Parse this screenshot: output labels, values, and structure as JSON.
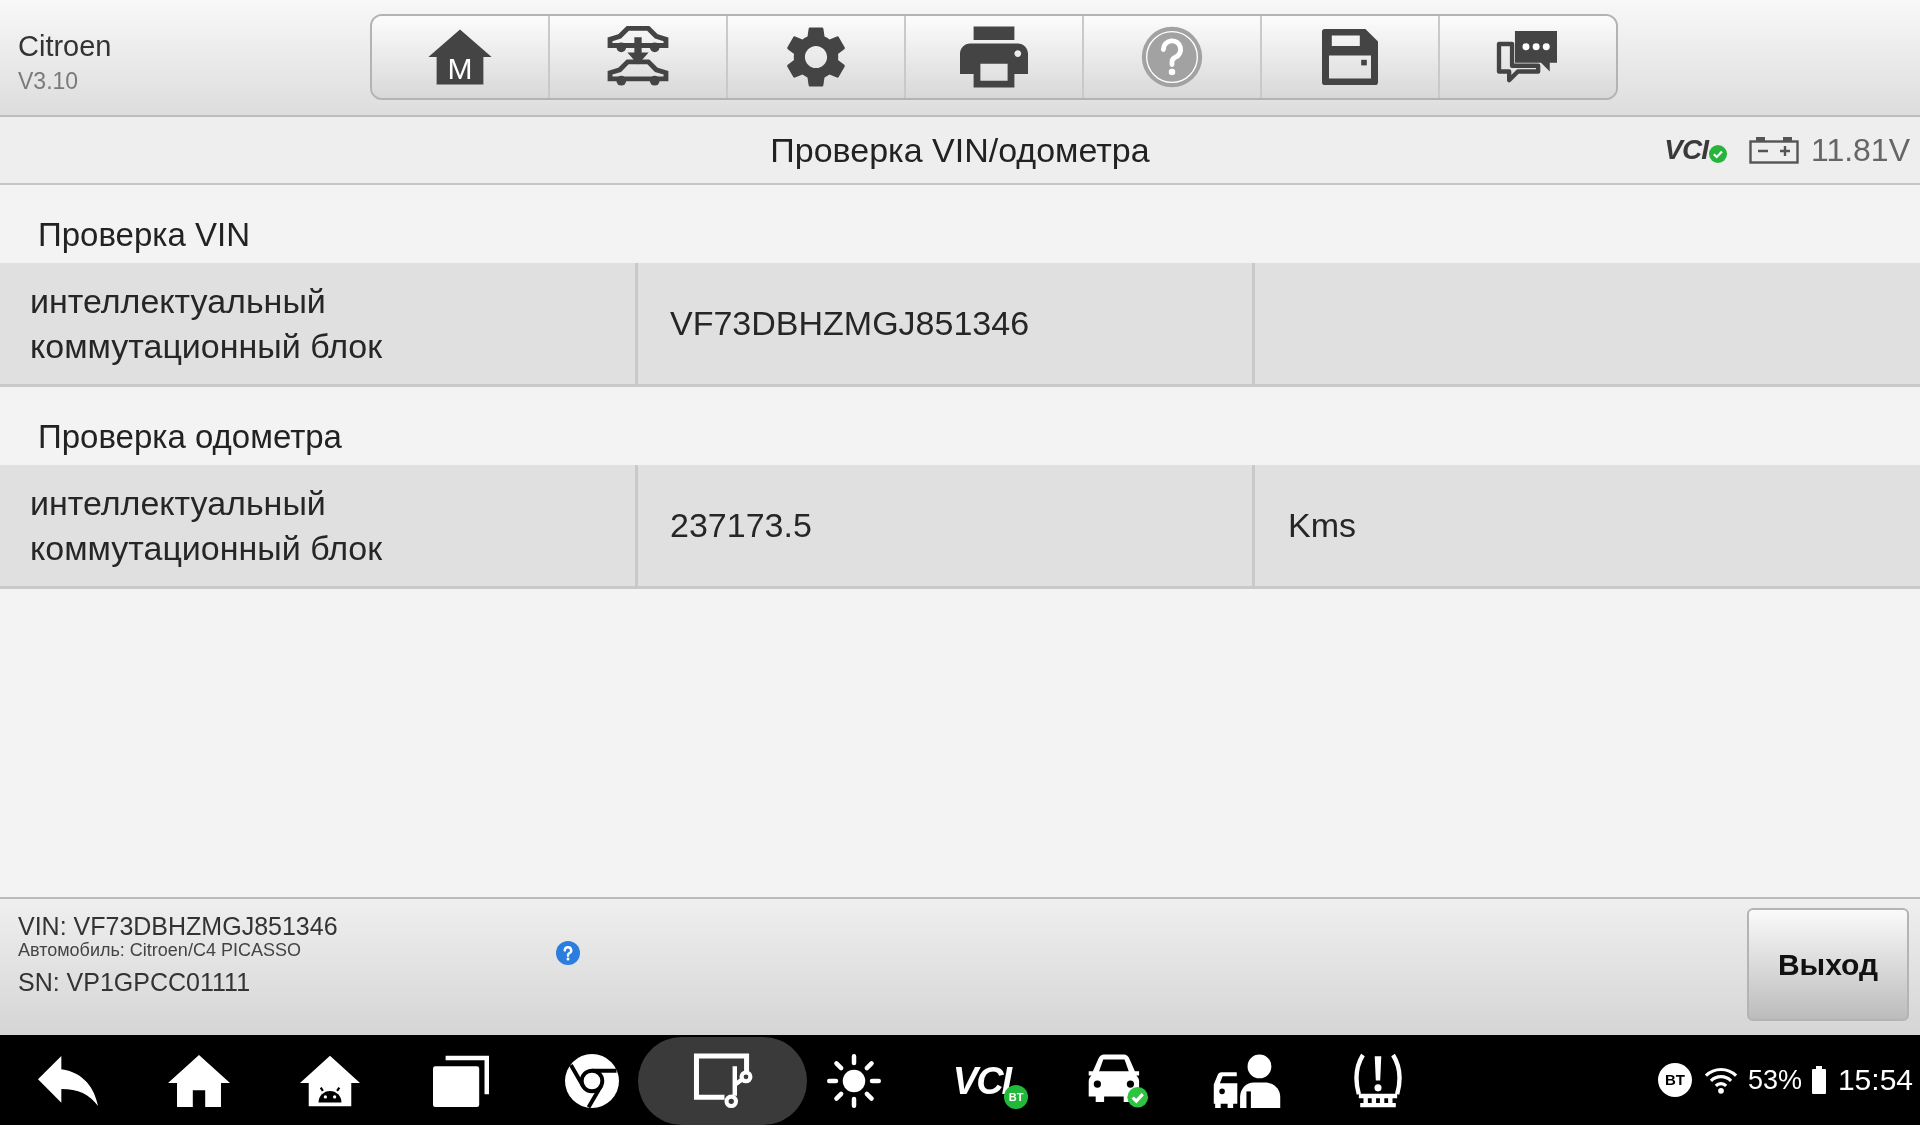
{
  "header": {
    "app_name": "Citroen",
    "version": "V3.10"
  },
  "toolbar": {
    "buttons": [
      {
        "label": "M",
        "disabled": false
      },
      {
        "disabled": false
      },
      {
        "disabled": false
      },
      {
        "disabled": false
      },
      {
        "disabled": true
      },
      {
        "disabled": false
      },
      {
        "disabled": false
      }
    ]
  },
  "title_bar": {
    "title": "Проверка VIN/одометра",
    "vci_label": "VCI",
    "voltage": "11.81V"
  },
  "sections": [
    {
      "title": "Проверка VIN",
      "rows": [
        {
          "name": "интеллектуальный коммутационный блок",
          "value": "VF73DBHZMGJ851346"
        }
      ]
    },
    {
      "title": "Проверка одометра",
      "rows": [
        {
          "name": "интеллектуальный коммутационный блок",
          "value": "237173.5",
          "unit": "Kms"
        }
      ]
    }
  ],
  "footer": {
    "vin": "VIN: VF73DBHZMGJ851346",
    "vehicle": "Автомобиль: Citroen/C4 PICASSO",
    "serial_number": "SN: VP1GPCC01111",
    "exit_button": "Выход"
  },
  "nav_bar": {
    "buttons": [
      {
        "selected": false
      },
      {
        "selected": false
      },
      {
        "selected": false
      },
      {
        "selected": false
      },
      {
        "selected": false
      },
      {
        "selected": true
      },
      {
        "selected": false
      },
      {
        "selected": false,
        "label": "VCI",
        "badge": "BT"
      },
      {
        "selected": false
      },
      {
        "selected": false
      },
      {
        "selected": false
      }
    ],
    "status": {
      "bluetooth": "BT",
      "battery": "53%",
      "time": "15:54"
    }
  }
}
